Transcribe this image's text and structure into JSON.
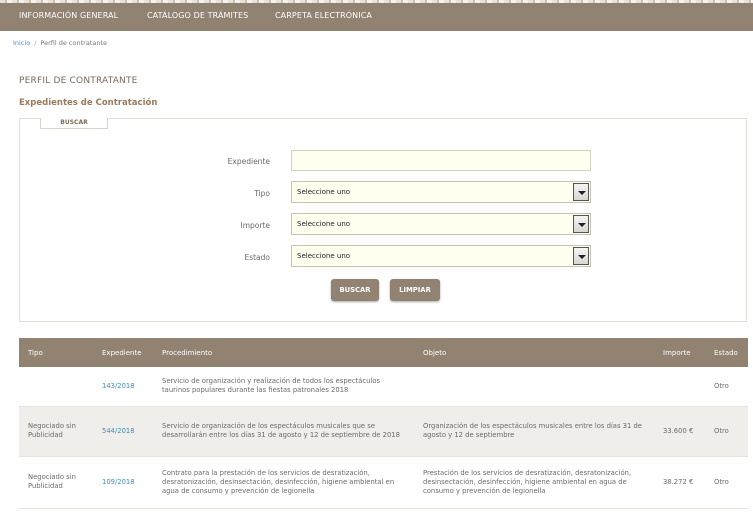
{
  "nav": {
    "items": [
      {
        "label": "INFORMACIÓN GENERAL"
      },
      {
        "label": "CATÁLOGO DE TRÁMITES"
      },
      {
        "label": "CARPETA ELECTRÓNICA"
      }
    ]
  },
  "breadcrumb": {
    "home": "Inicio",
    "separator": "/",
    "current": "Perfil de contratante"
  },
  "page": {
    "title": "PERFIL DE CONTRATANTE",
    "subtitle": "Expedientes de Contratación"
  },
  "search": {
    "tab_label": "BUSCAR",
    "fields": {
      "expediente": {
        "label": "Expediente",
        "value": ""
      },
      "tipo": {
        "label": "Tipo",
        "selected": "Seleccione uno"
      },
      "importe": {
        "label": "Importe",
        "selected": "Seleccione uno"
      },
      "estado": {
        "label": "Estado",
        "selected": "Seleccione uno"
      }
    },
    "buttons": {
      "search": "BUSCAR",
      "clear": "LIMPIAR"
    }
  },
  "table": {
    "headers": {
      "tipo": "Tipo",
      "expediente": "Expediente",
      "procedimiento": "Procedimiento",
      "objeto": "Objeto",
      "importe": "Importe",
      "estado": "Estado"
    },
    "rows": [
      {
        "tipo": "",
        "expediente": "143/2018",
        "procedimiento": "Servicio de organización y realización de todos los espectáculos taurinos populares durante las fiestas patronales 2018",
        "objeto": "",
        "importe": "",
        "estado": "Otro"
      },
      {
        "tipo": "Negociado sin Publicidad",
        "expediente": "544/2018",
        "procedimiento": "Servicio de organización de los espectáculos musicales que se desarrollarán entre los días 31 de agosto y 12 de septiembre de 2018",
        "objeto": "Organización de los espectáculos musicales entre los días 31 de agosto y 12 de septiembre",
        "importe": "33.600 €",
        "estado": "Otro"
      },
      {
        "tipo": "Negociado sin Publicidad",
        "expediente": "109/2018",
        "procedimiento": "Contrato para la prestación de los servicios de desratización, desratonización, desinsectación, desinfección, higiene ambiental en agua de consumo y prevención de legionella",
        "objeto": "Prestación de los servicios de desratización, desratonización, desinsectación, desinfección, higiene ambiental en agua de consumo y prevención de legionella",
        "importe": "38.272 €",
        "estado": "Otro"
      }
    ]
  },
  "colors": {
    "nav_background": "#928272",
    "link": "#3f8ec2",
    "input_background": "#fffff0"
  }
}
